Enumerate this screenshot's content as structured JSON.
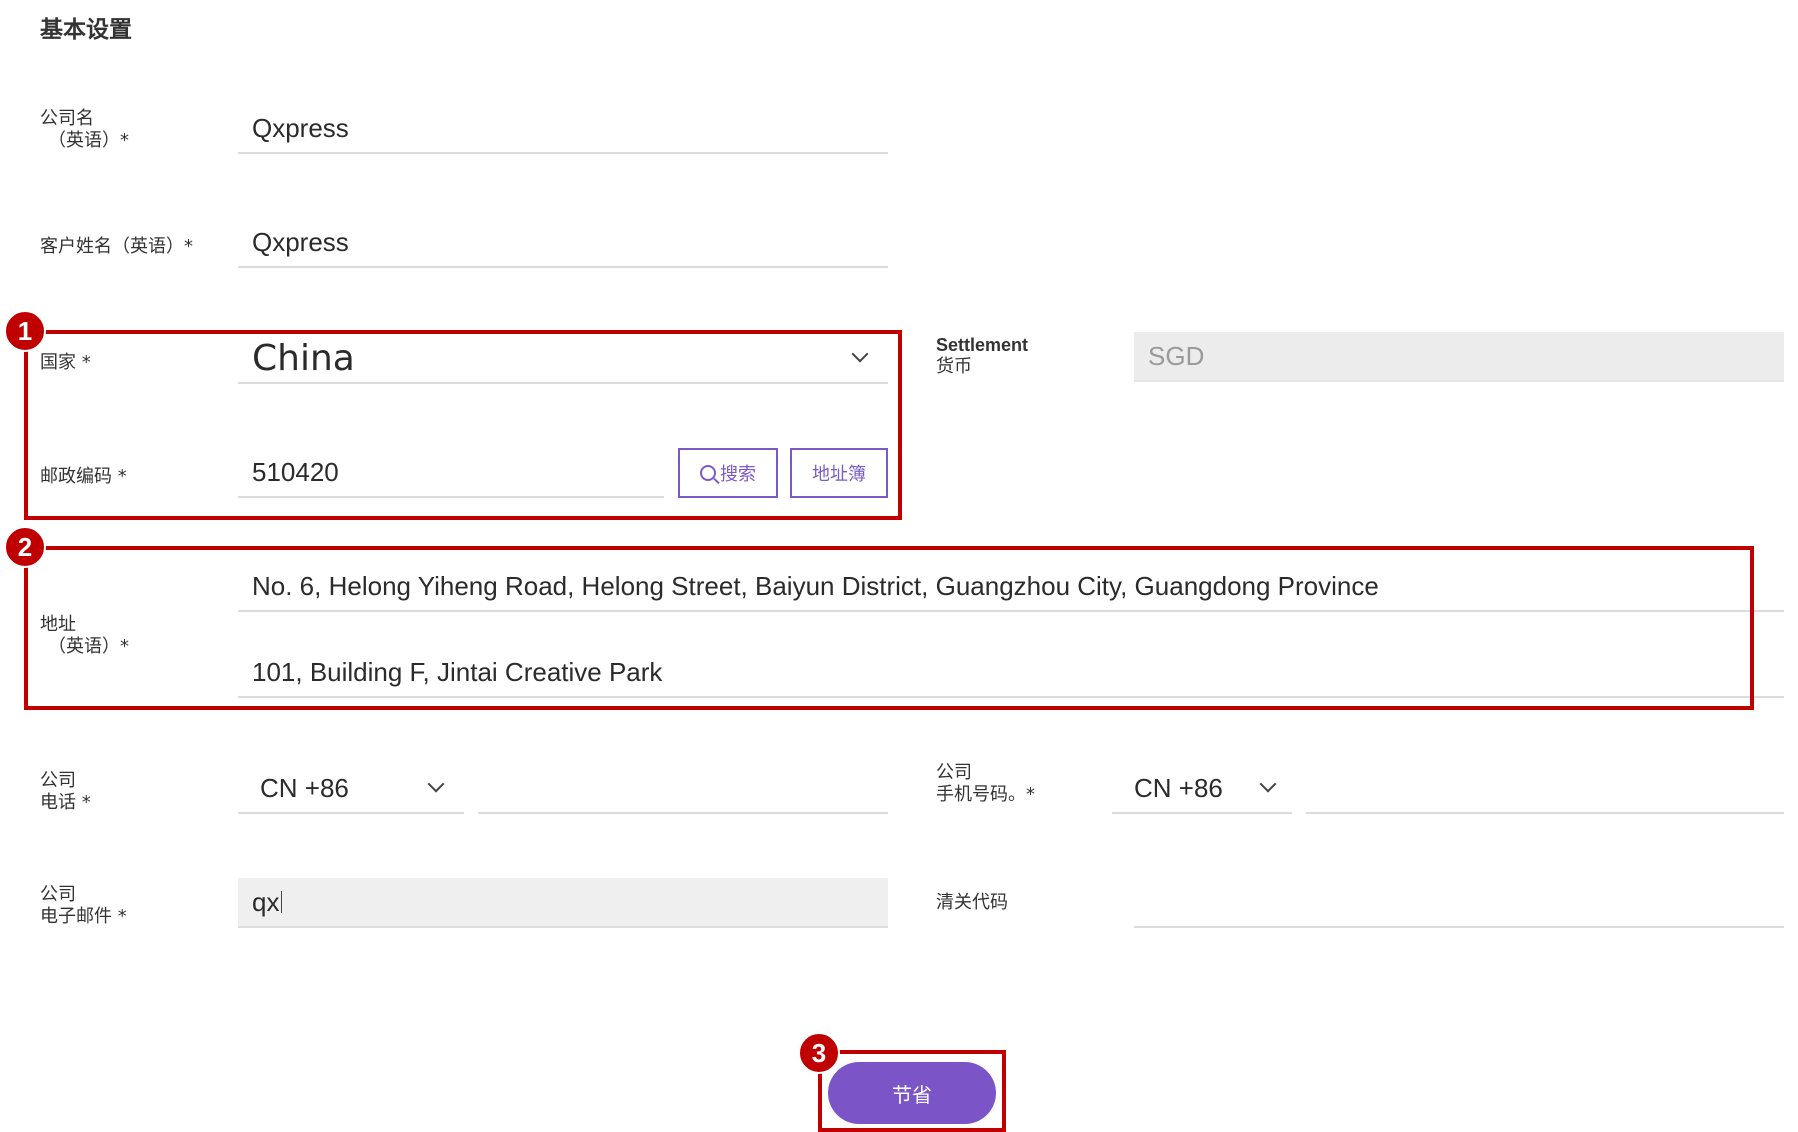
{
  "section_title": "基本设置",
  "company_name": {
    "label_line1": "公司名",
    "label_line2": "（英语）*",
    "value": "Qxpress"
  },
  "customer_name": {
    "label": "客户姓名（英语）*",
    "value": "Qxpress"
  },
  "country": {
    "label": "国家 *",
    "value": "China"
  },
  "postal_code": {
    "label": "邮政编码 *",
    "value": "510420",
    "search_label": "搜索",
    "address_book_label": "地址簿"
  },
  "settlement": {
    "label_line1": "Settlement",
    "label_line2": "货币",
    "value": "SGD"
  },
  "address": {
    "label_line1": "地址",
    "label_line2": "（英语）*",
    "line1": "No. 6, Helong Yiheng Road, Helong Street, Baiyun District, Guangzhou City, Guangdong Province",
    "line2": "101, Building F, Jintai Creative Park"
  },
  "company_phone": {
    "label_line1": "公司",
    "label_line2": "电话 *",
    "country_code": "CN +86",
    "value": ""
  },
  "company_mobile": {
    "label_line1": "公司",
    "label_line2": "手机号码。*",
    "country_code": "CN +86",
    "value": ""
  },
  "company_email": {
    "label_line1": "公司",
    "label_line2": "电子邮件 *",
    "value": "qx"
  },
  "customs_code": {
    "label": "清关代码",
    "value": ""
  },
  "save_button": "节省",
  "badges": [
    "1",
    "2",
    "3"
  ],
  "colors": {
    "accent": "#7b55c7",
    "annotation_red": "#c00000"
  }
}
